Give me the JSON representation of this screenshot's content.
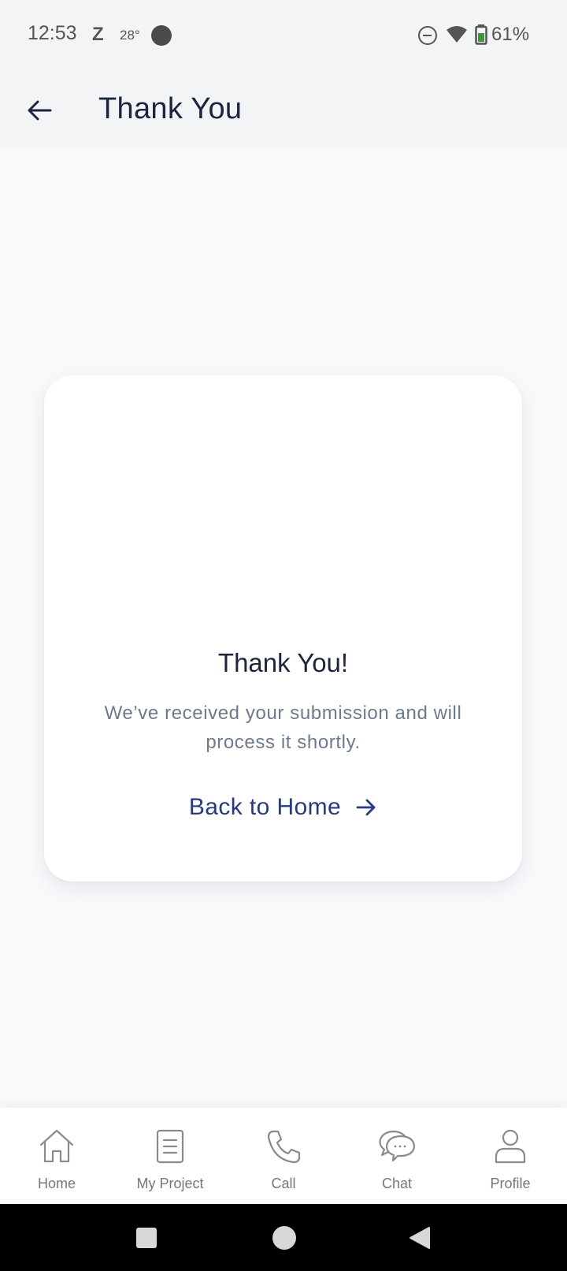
{
  "status_bar": {
    "time": "12:53",
    "z_label": "Z",
    "temperature": "28°",
    "battery": "61%",
    "icons": [
      "dnd-icon",
      "wifi-icon",
      "battery-icon"
    ]
  },
  "app_bar": {
    "back_icon": "arrow-left-icon",
    "title": "Thank You"
  },
  "card": {
    "title": "Thank You!",
    "message": "We’ve received your submission and will process it shortly.",
    "action_label": "Back to Home",
    "action_icon": "arrow-right-icon"
  },
  "bottom_nav": {
    "items": [
      {
        "label": "Home",
        "icon": "home-icon"
      },
      {
        "label": "My Project",
        "icon": "document-icon"
      },
      {
        "label": "Call",
        "icon": "phone-icon"
      },
      {
        "label": "Chat",
        "icon": "chat-icon"
      },
      {
        "label": "Profile",
        "icon": "user-icon"
      }
    ]
  },
  "colors": {
    "primary_text": "#1c2540",
    "link": "#233a8a",
    "muted": "#6b7a90",
    "background": "#f8f9fb"
  }
}
